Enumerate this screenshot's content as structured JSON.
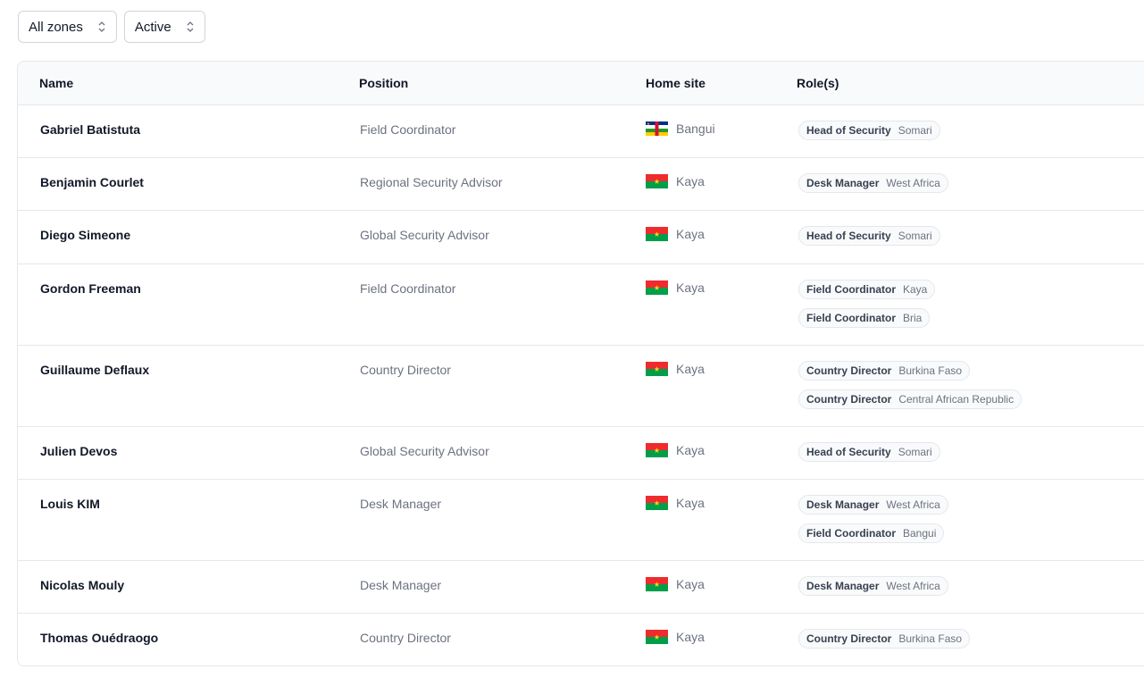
{
  "filters": {
    "zone": "All zones",
    "status": "Active"
  },
  "columns": {
    "name": "Name",
    "position": "Position",
    "home_site": "Home site",
    "roles": "Role(s)"
  },
  "colors": {
    "border": "#e5e7eb",
    "header_bg": "#f9fafb",
    "muted_text": "#6b7280"
  },
  "rows": [
    {
      "name": "Gabriel Batistuta",
      "position": "Field Coordinator",
      "site": "Bangui",
      "flag": "central-african-republic-flag",
      "roles": [
        {
          "role": "Head of Security",
          "zone": "Somari"
        }
      ]
    },
    {
      "name": "Benjamin Courlet",
      "position": "Regional Security Advisor",
      "site": "Kaya",
      "flag": "burkina-faso-flag",
      "roles": [
        {
          "role": "Desk Manager",
          "zone": "West Africa"
        }
      ]
    },
    {
      "name": "Diego Simeone",
      "position": "Global Security Advisor",
      "site": "Kaya",
      "flag": "burkina-faso-flag",
      "roles": [
        {
          "role": "Head of Security",
          "zone": "Somari"
        }
      ]
    },
    {
      "name": "Gordon Freeman",
      "position": "Field Coordinator",
      "site": "Kaya",
      "flag": "burkina-faso-flag",
      "roles": [
        {
          "role": "Field Coordinator",
          "zone": "Kaya"
        },
        {
          "role": "Field Coordinator",
          "zone": "Bria"
        }
      ]
    },
    {
      "name": "Guillaume Deflaux",
      "position": "Country Director",
      "site": "Kaya",
      "flag": "burkina-faso-flag",
      "roles": [
        {
          "role": "Country Director",
          "zone": "Burkina Faso"
        },
        {
          "role": "Country Director",
          "zone": "Central African Republic"
        }
      ]
    },
    {
      "name": "Julien Devos",
      "position": "Global Security Advisor",
      "site": "Kaya",
      "flag": "burkina-faso-flag",
      "roles": [
        {
          "role": "Head of Security",
          "zone": "Somari"
        }
      ]
    },
    {
      "name": "Louis KIM",
      "position": "Desk Manager",
      "site": "Kaya",
      "flag": "burkina-faso-flag",
      "roles": [
        {
          "role": "Desk Manager",
          "zone": "West Africa"
        },
        {
          "role": "Field Coordinator",
          "zone": "Bangui"
        }
      ]
    },
    {
      "name": "Nicolas Mouly",
      "position": "Desk Manager",
      "site": "Kaya",
      "flag": "burkina-faso-flag",
      "roles": [
        {
          "role": "Desk Manager",
          "zone": "West Africa"
        }
      ]
    },
    {
      "name": "Thomas Ouédraogo",
      "position": "Country Director",
      "site": "Kaya",
      "flag": "burkina-faso-flag",
      "roles": [
        {
          "role": "Country Director",
          "zone": "Burkina Faso"
        }
      ]
    }
  ]
}
